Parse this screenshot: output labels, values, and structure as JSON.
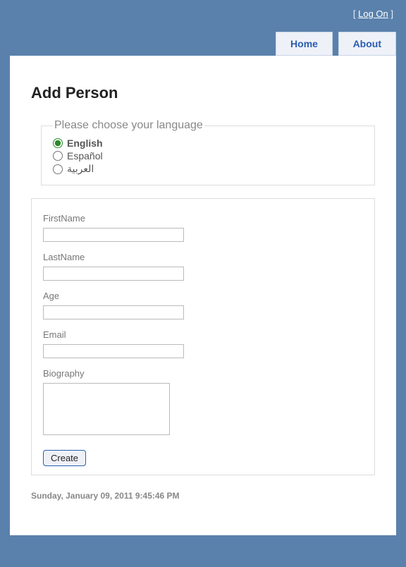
{
  "topbar": {
    "log_on": "Log On"
  },
  "nav": {
    "home": "Home",
    "about": "About"
  },
  "page_title": "Add Person",
  "language": {
    "legend": "Please choose your language",
    "english": "English",
    "spanish": "Español",
    "arabic": "العربية"
  },
  "form": {
    "first_name_label": "FirstName",
    "last_name_label": "LastName",
    "age_label": "Age",
    "email_label": "Email",
    "biography_label": "Biography",
    "submit_label": "Create"
  },
  "footer": {
    "timestamp": "Sunday, January 09, 2011 9:45:46 PM"
  }
}
